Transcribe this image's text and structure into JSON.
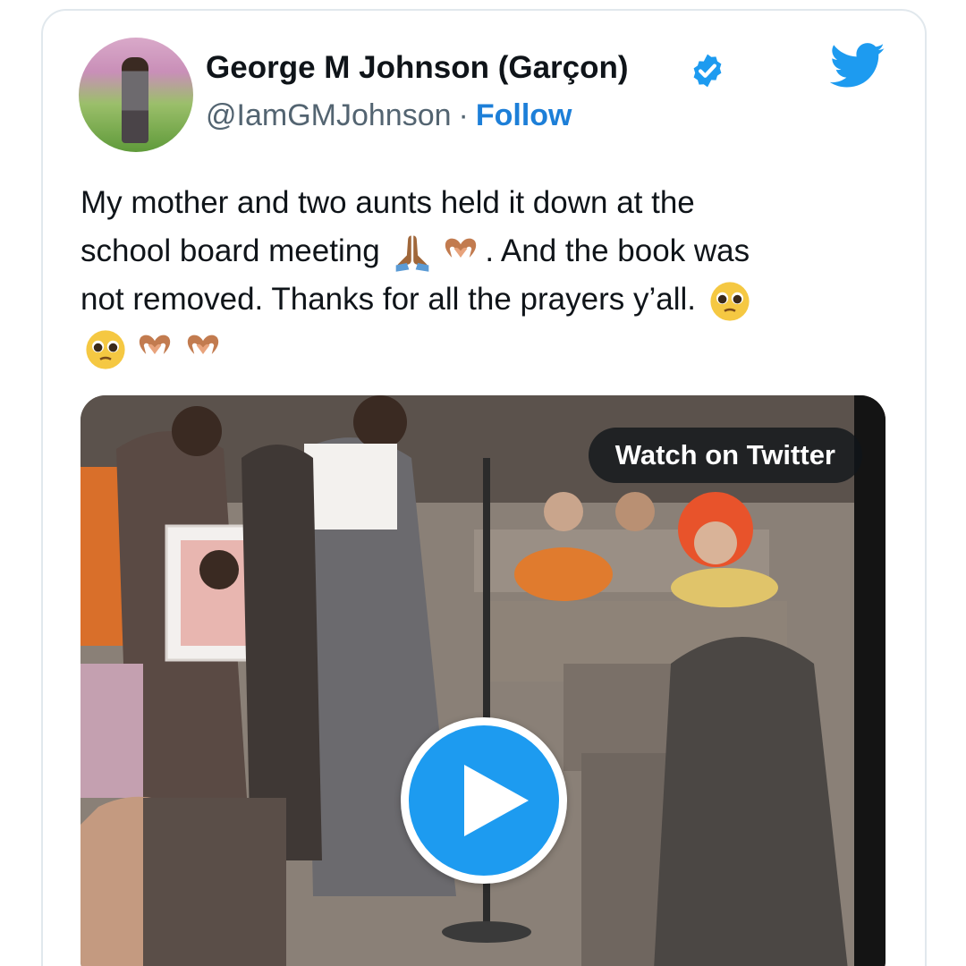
{
  "tweet": {
    "author_name": "George M Johnson (Garçon)",
    "handle": "@IamGMJohnson",
    "separator": "·",
    "follow_label": "Follow",
    "text_line1": "My mother and two aunts held it down at the",
    "text_line2_a": "school board meeting ",
    "text_line2_b": ". And the book was",
    "text_line3": "not removed. Thanks for all the prayers y’all. "
  },
  "media": {
    "watch_label": "Watch on Twitter"
  },
  "icons": {
    "verified": "verified-badge-icon",
    "brand": "twitter-bird-icon",
    "play": "play-icon",
    "emojis": [
      "folded-hands-emoji",
      "heart-hands-emoji",
      "pleading-face-emoji"
    ]
  },
  "colors": {
    "accent": "#1d9bf0",
    "link": "#1d7fd8",
    "text": "#0f1419",
    "secondary_text": "#536471",
    "border": "#e1e8ed"
  }
}
